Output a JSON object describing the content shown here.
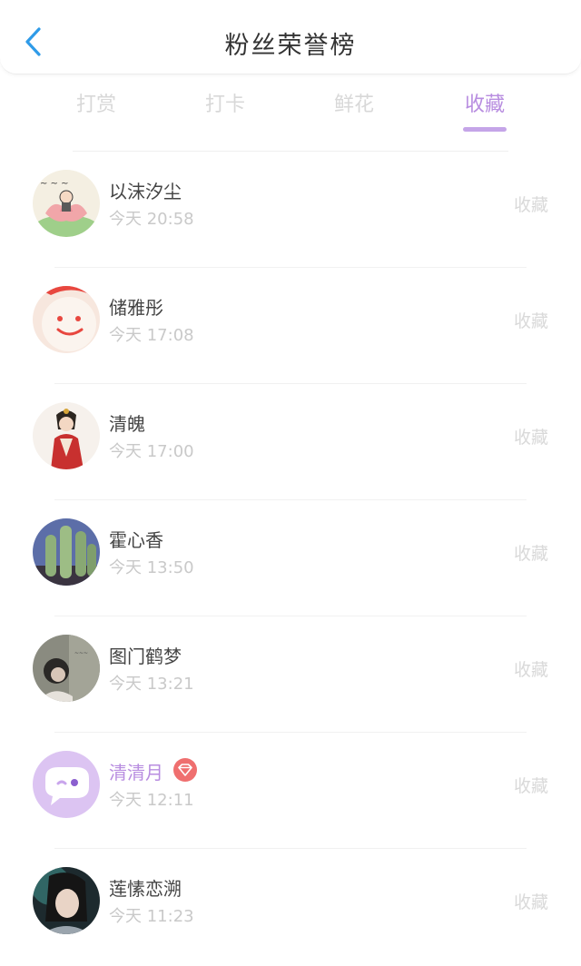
{
  "header": {
    "title": "粉丝荣誉榜"
  },
  "tabs": [
    {
      "label": "打赏",
      "active": false
    },
    {
      "label": "打卡",
      "active": false
    },
    {
      "label": "鲜花",
      "active": false
    },
    {
      "label": "收藏",
      "active": true
    }
  ],
  "colors": {
    "accent": "#b88de0",
    "badge": "#ef6f6f",
    "back": "#2f9be8"
  },
  "fans": [
    {
      "name": "以沫汐尘",
      "time": "今天 20:58",
      "tag": "收藏",
      "avatar": "lotus-doodle-avatar"
    },
    {
      "name": "储雅彤",
      "time": "今天 17:08",
      "tag": "收藏",
      "avatar": "smiley-cake-avatar"
    },
    {
      "name": "清魄",
      "time": "今天 17:00",
      "tag": "收藏",
      "avatar": "ancient-lady-avatar"
    },
    {
      "name": "霍心香",
      "time": "今天 13:50",
      "tag": "收藏",
      "avatar": "cactus-avatar"
    },
    {
      "name": "图门鹤梦",
      "time": "今天 13:21",
      "tag": "收藏",
      "avatar": "girl-photo-avatar"
    },
    {
      "name": "清清月",
      "time": "今天 12:11",
      "tag": "收藏",
      "avatar": "chat-bubble-avatar",
      "vip": true
    },
    {
      "name": "莲愫恋溯",
      "time": "今天 11:23",
      "tag": "收藏",
      "avatar": "warrior-avatar"
    }
  ]
}
